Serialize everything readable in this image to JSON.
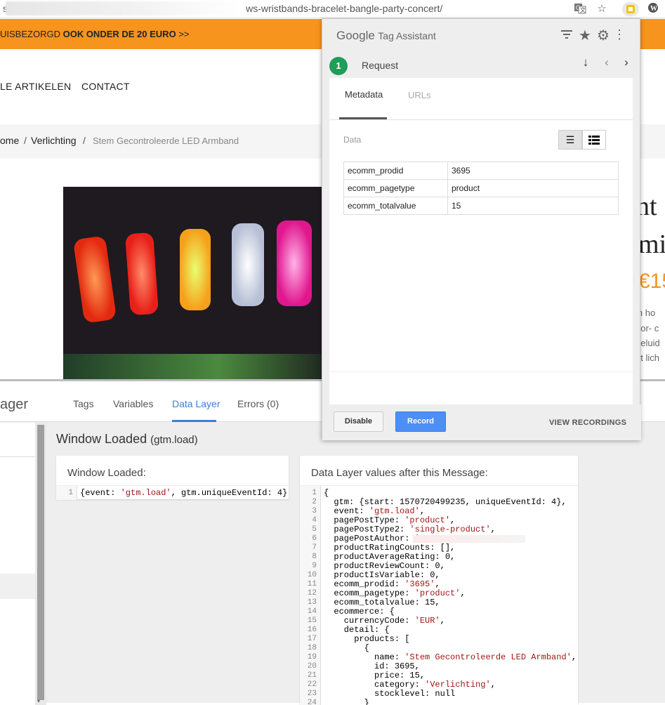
{
  "browser": {
    "url_tail": "ws-wristbands-bracelet-bangle-party-concert/",
    "url_head": "sl",
    "icons": [
      "translate-icon",
      "star-icon",
      "tag-assistant-icon",
      "wordpress-icon"
    ]
  },
  "site": {
    "banner_prefix": "UISBEZORGD",
    "banner_strong": "OOK ONDER DE 20 EURO",
    "banner_suffix": ">>",
    "nav": [
      "LE ARTIKELEN",
      "CONTACT"
    ],
    "breadcrumb": [
      "ome",
      "/",
      "Verlichting",
      "/",
      "Stem Gecontroleerde LED Armband"
    ],
    "title_line1": "nt",
    "title_line2": "m",
    "title_line2_suffix": "i",
    "price": "€15",
    "desc_lines": [
      "in ho",
      "oor- c",
      "geluid",
      "et lich"
    ]
  },
  "gtm": {
    "logo": "ager",
    "tabs": [
      "Tags",
      "Variables",
      "Data Layer",
      "Errors (0)"
    ],
    "event_title": "Window Loaded",
    "event_sub": "(gtm.load)",
    "msg_card_title": "Window Loaded:",
    "msg_line_num": "1",
    "msg_line": "{event: 'gtm.load', gtm.uniqueEventId: 4}",
    "dl_card_title": "Data Layer values after this Message:",
    "dl_lines": [
      "{",
      "  gtm: {start: 1570720499235, uniqueEventId: 4},",
      "  event: 'gtm.load',",
      "  pagePostType: 'product',",
      "  pagePostType2: 'single-product',",
      "  pagePostAuthor: '",
      "  productRatingCounts: [],",
      "  productAverageRating: 0,",
      "  productReviewCount: 0,",
      "  productIsVariable: 0,",
      "  ecomm_prodid: '3695',",
      "  ecomm_pagetype: 'product',",
      "  ecomm_totalvalue: 15,",
      "  ecommerce: {",
      "    currencyCode: 'EUR',",
      "    detail: {",
      "      products: [",
      "        {",
      "          name: 'Stem Gecontroleerde LED Armband',",
      "          id: 3695,",
      "          price: 15,",
      "          category: 'Verlichting',",
      "          stocklevel: null",
      "        }"
    ]
  },
  "tag_assistant": {
    "brand": "Google",
    "product": "Tag Assistant",
    "header_icons": [
      "filter-icon",
      "star-icon",
      "gear-icon",
      "more-vert-icon"
    ],
    "badge": "1",
    "request_label": "Request",
    "tabs": [
      "Metadata",
      "URLs"
    ],
    "data_label": "Data",
    "rows": [
      {
        "key": "ecomm_prodid",
        "value": "3695"
      },
      {
        "key": "ecomm_pagetype",
        "value": "product"
      },
      {
        "key": "ecomm_totalvalue",
        "value": "15"
      }
    ],
    "buttons": {
      "disable": "Disable",
      "record": "Record",
      "view_recordings": "VIEW RECORDINGS"
    }
  }
}
